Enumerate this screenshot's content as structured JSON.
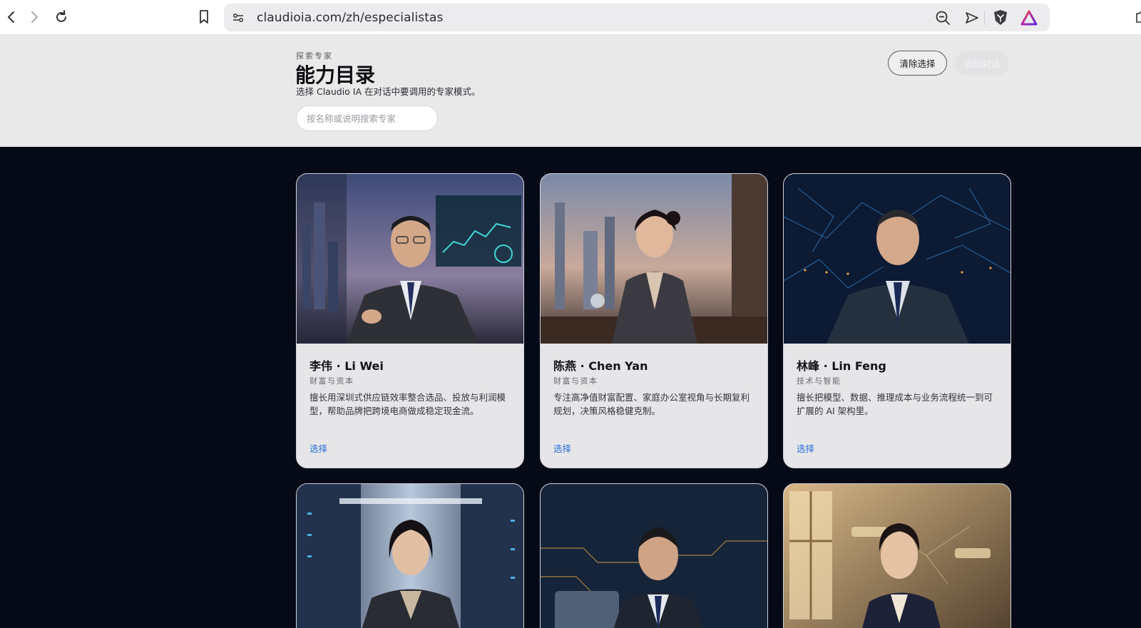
{
  "browser": {
    "url": "claudioia.com/zh/especialistas"
  },
  "header": {
    "eyebrow": "探索专家",
    "title": "能力目录",
    "subtitle": "选择 Claudio IA 在对话中要调用的专家模式。",
    "search_placeholder": "按名称或说明搜索专家",
    "clear_label": "清除选择",
    "back_label": "返回对话"
  },
  "cards": [
    {
      "name": "李伟 · Li Wei",
      "category": "财富与资本",
      "description": "擅长用深圳式供应链效率整合选品、投放与利润模型，帮助品牌把跨境电商做成稳定现金流。",
      "select": "选择"
    },
    {
      "name": "陈燕 · Chen Yan",
      "category": "财富与资本",
      "description": "专注高净值财富配置、家庭办公室视角与长期复利规划，决策风格稳健克制。",
      "select": "选择"
    },
    {
      "name": "林峰 · Lin Feng",
      "category": "技术与智能",
      "description": "擅长把模型、数据、推理成本与业务流程统一到可扩展的 AI 架构里。",
      "select": "选择"
    }
  ],
  "colors": {
    "accent": "#2a6fd6",
    "page_background": "#060a17",
    "header_background": "#e9e9ea",
    "card_background": "#e6e6e8"
  }
}
